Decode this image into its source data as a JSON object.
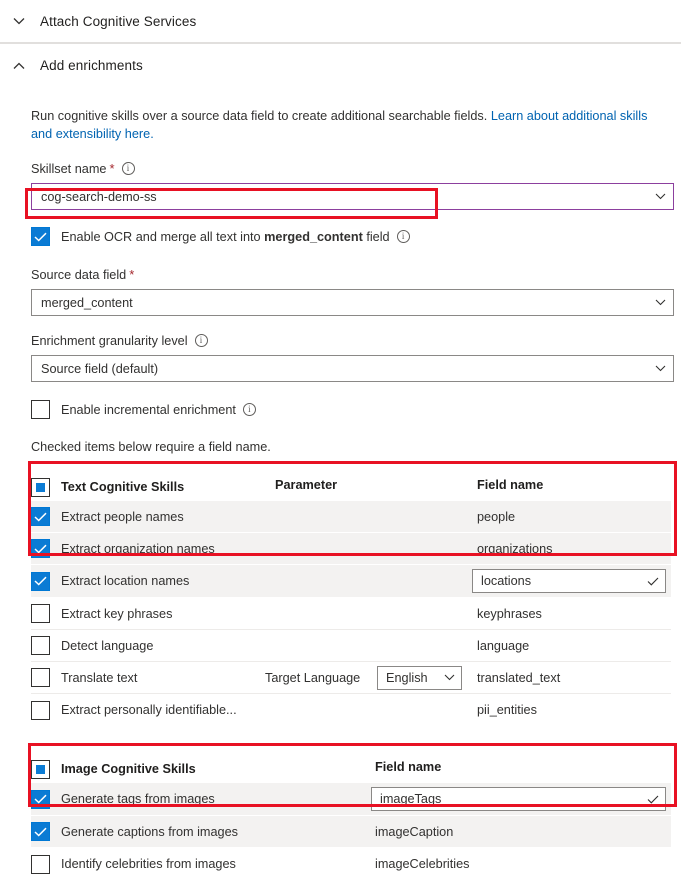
{
  "sections": {
    "attach": {
      "title": "Attach Cognitive Services",
      "chevron": "chevron-down"
    },
    "enrich": {
      "title": "Add enrichments",
      "chevron": "chevron-up"
    }
  },
  "intro": {
    "text": "Run cognitive skills over a source data field to create additional searchable fields. ",
    "link_text": "Learn about additional skills and extensibility here."
  },
  "skillset_name": {
    "label": "Skillset name",
    "required_marker": "*",
    "info": "ⓘ",
    "value": "cog-search-demo-ss"
  },
  "ocr": {
    "label_before": "Enable OCR and merge all text into ",
    "label_bold": "merged_content",
    "label_after": " field",
    "checked": true
  },
  "source_data_field": {
    "label": "Source data field",
    "required_marker": "*",
    "value": "merged_content"
  },
  "granularity": {
    "label": "Enrichment granularity level",
    "value": "Source field (default)"
  },
  "incremental": {
    "label": "Enable incremental enrichment",
    "checked": false
  },
  "note": "Checked items below require a field name.",
  "text_skills": {
    "header": {
      "title": "Text Cognitive Skills",
      "col_parameter": "Parameter",
      "col_field_name": "Field name",
      "checkbox_state": "indeterminate"
    },
    "rows": [
      {
        "label": "Extract people names",
        "checked": true,
        "field_name": "people",
        "field_editable": false,
        "parameter": ""
      },
      {
        "label": "Extract organization names",
        "checked": true,
        "field_name": "organizations",
        "field_editable": false,
        "parameter": ""
      },
      {
        "label": "Extract location names",
        "checked": true,
        "field_name": "locations",
        "field_editable": true,
        "parameter": ""
      },
      {
        "label": "Extract key phrases",
        "checked": false,
        "field_name": "keyphrases",
        "field_editable": false,
        "parameter": ""
      },
      {
        "label": "Detect language",
        "checked": false,
        "field_name": "language",
        "field_editable": false,
        "parameter": ""
      },
      {
        "label": "Translate text",
        "checked": false,
        "field_name": "translated_text",
        "field_editable": false,
        "parameter": "Target Language",
        "parameter_value": "English"
      },
      {
        "label": "Extract personally identifiable...",
        "checked": false,
        "field_name": "pii_entities",
        "field_editable": false,
        "parameter": ""
      }
    ]
  },
  "image_skills": {
    "header": {
      "title": "Image Cognitive Skills",
      "col_field_name": "Field name",
      "checkbox_state": "indeterminate"
    },
    "rows": [
      {
        "label": "Generate tags from images",
        "checked": true,
        "field_name": "imageTags",
        "field_editable": true
      },
      {
        "label": "Generate captions from images",
        "checked": true,
        "field_name": "imageCaption",
        "field_editable": false
      },
      {
        "label": "Identify celebrities from images",
        "checked": false,
        "field_name": "imageCelebrities",
        "field_editable": false
      }
    ]
  },
  "colors": {
    "accent": "#0b7bd4",
    "link": "#0063b1",
    "required": "#a4262c",
    "annotation": "#e81123",
    "focus_border": "#8c3f9e",
    "row_checked_bg": "#f3f2f1"
  }
}
